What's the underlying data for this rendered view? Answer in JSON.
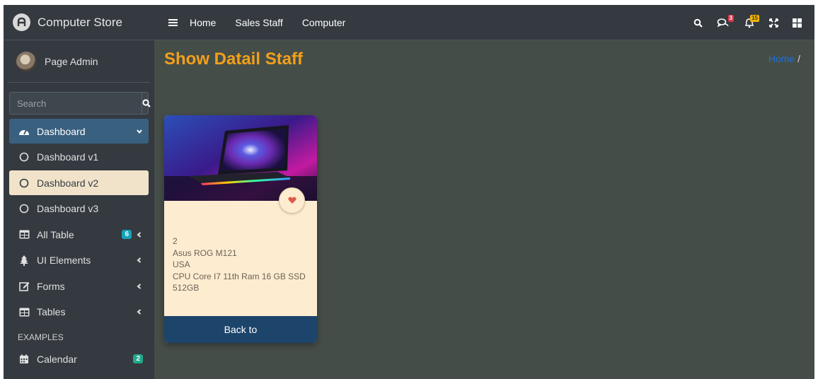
{
  "brand": {
    "name": "Computer Store"
  },
  "user": {
    "name": "Page Admin"
  },
  "search": {
    "placeholder": "Search"
  },
  "sidebar": {
    "items": [
      {
        "label": "Dashboard"
      },
      {
        "label": "Dashboard v1"
      },
      {
        "label": "Dashboard v2"
      },
      {
        "label": "Dashboard v3"
      },
      {
        "label": "All Table",
        "badge": "6"
      },
      {
        "label": "UI Elements"
      },
      {
        "label": "Forms"
      },
      {
        "label": "Tables"
      }
    ],
    "section_header": "EXAMPLES",
    "calendar": {
      "label": "Calendar",
      "badge": "2"
    }
  },
  "topnav": {
    "links": [
      "Home",
      "Sales Staff",
      "Computer"
    ],
    "messages_badge": "3",
    "notifications_badge": "15"
  },
  "page": {
    "title": "Show Datail Staff",
    "breadcrumb_home": "Home",
    "breadcrumb_sep": "/"
  },
  "card": {
    "id": "2",
    "name": "Asus ROG M121",
    "origin": "USA",
    "specs": "CPU Core I7 11th Ram 16 GB SSD 512GB",
    "back_label": "Back to"
  },
  "colors": {
    "accent_title": "#f2a01b",
    "active_nav": "#3a607f",
    "selected_nav": "#f0e3ca",
    "card_bg": "#fdecd0",
    "card_button": "#1d446a"
  }
}
